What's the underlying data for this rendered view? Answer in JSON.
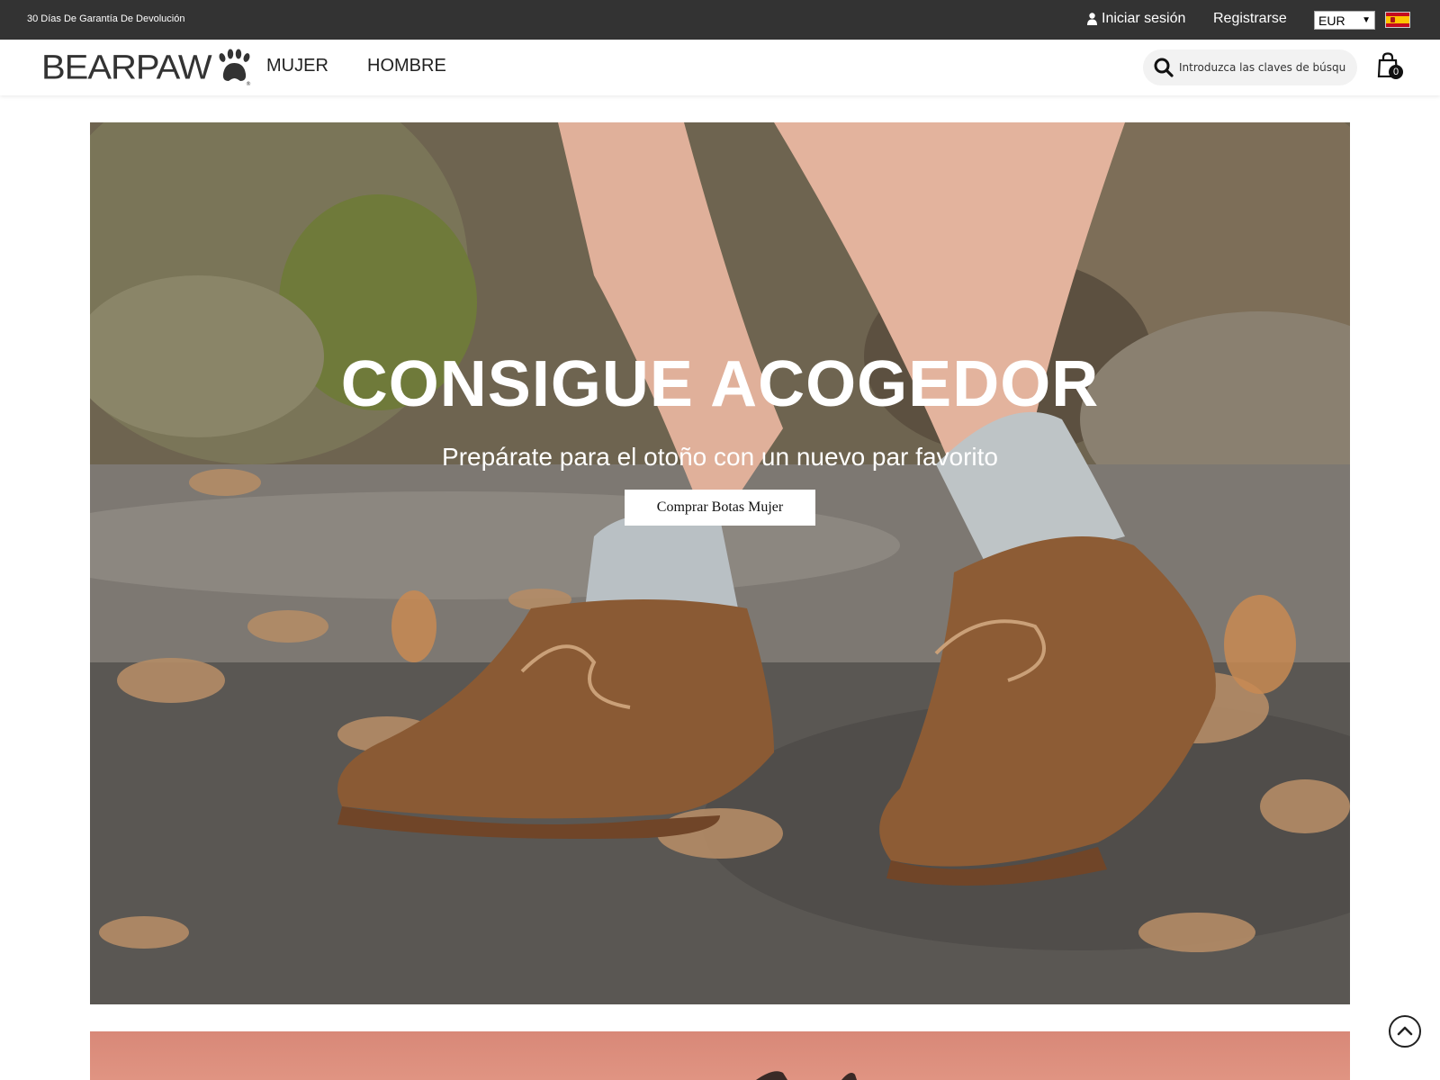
{
  "topbar": {
    "promo": "30 Días De Garantía De Devolución",
    "login_label": "Iniciar sesión",
    "register_label": "Registrarse",
    "currency": "EUR"
  },
  "header": {
    "logo_text": "BEARPAW",
    "nav": [
      "MUJER",
      "HOMBRE"
    ],
    "search_placeholder": "Introduzca las claves de búsqu",
    "cart_count": "0"
  },
  "hero": {
    "title": "CONSIGUE ACOGEDOR",
    "subtitle": "Prepárate para el otoño con un nuevo par favorito",
    "cta": "Comprar Botas Mujer"
  },
  "colors": {
    "topbar_bg": "#333333",
    "accent": "#ffffff"
  }
}
